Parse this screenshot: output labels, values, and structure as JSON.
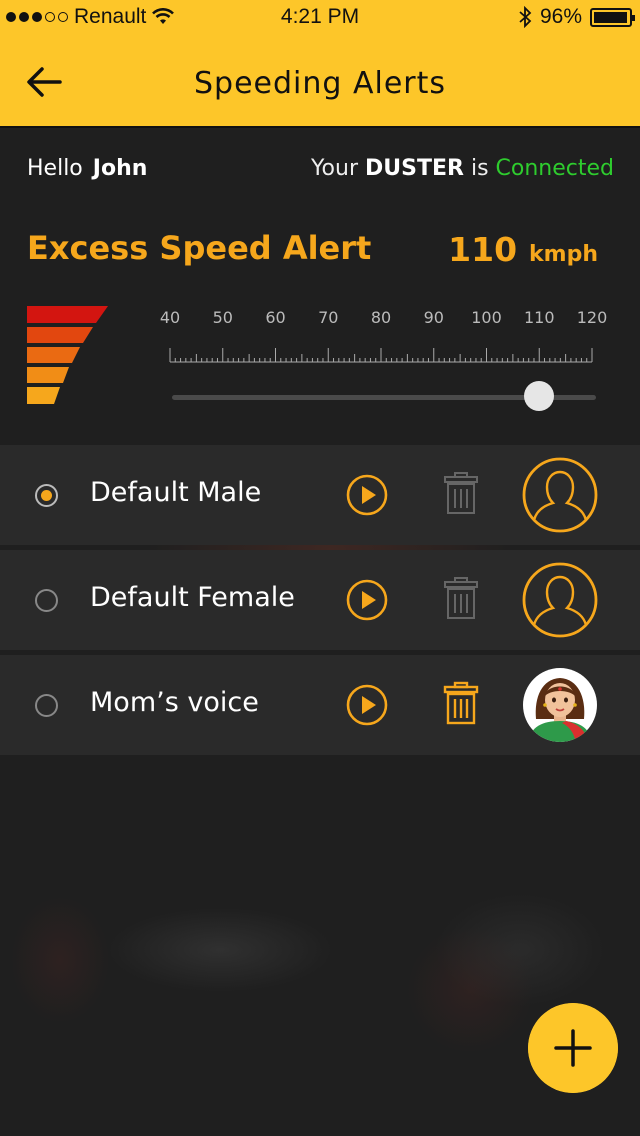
{
  "status_bar": {
    "carrier": "Renault",
    "time": "4:21 PM",
    "battery": "96%",
    "battery_level": 0.96,
    "signal_bars_filled": 3,
    "signal_bars_total": 5
  },
  "header": {
    "title": "Speeding  Alerts",
    "back_icon": "arrow-left-icon"
  },
  "greeting": {
    "hello": "Hello",
    "name": "John"
  },
  "connection": {
    "prefix": "Your",
    "car": "DUSTER",
    "mid": "is",
    "status": "Connected"
  },
  "alert": {
    "title": "Excess Speed Alert",
    "value": "110",
    "unit": "kmph",
    "scale_labels": [
      "40",
      "50",
      "60",
      "70",
      "80",
      "90",
      "100",
      "110",
      "120"
    ],
    "scale_min": 40,
    "scale_max": 120,
    "current_speed": 110
  },
  "voices": [
    {
      "name": "Default Male",
      "selected": true,
      "deletable": false,
      "avatar": "male-avatar-icon"
    },
    {
      "name": "Default Female",
      "selected": false,
      "deletable": false,
      "avatar": "female-avatar-icon"
    },
    {
      "name": "Mom’s voice",
      "selected": false,
      "deletable": true,
      "avatar": "woman-portrait-icon"
    }
  ],
  "fab": {
    "icon": "plus-icon"
  },
  "colors": {
    "accent": "#f6a71c",
    "header": "#fdc629",
    "connected": "#2ecc2e",
    "background": "#1f1f1f"
  }
}
